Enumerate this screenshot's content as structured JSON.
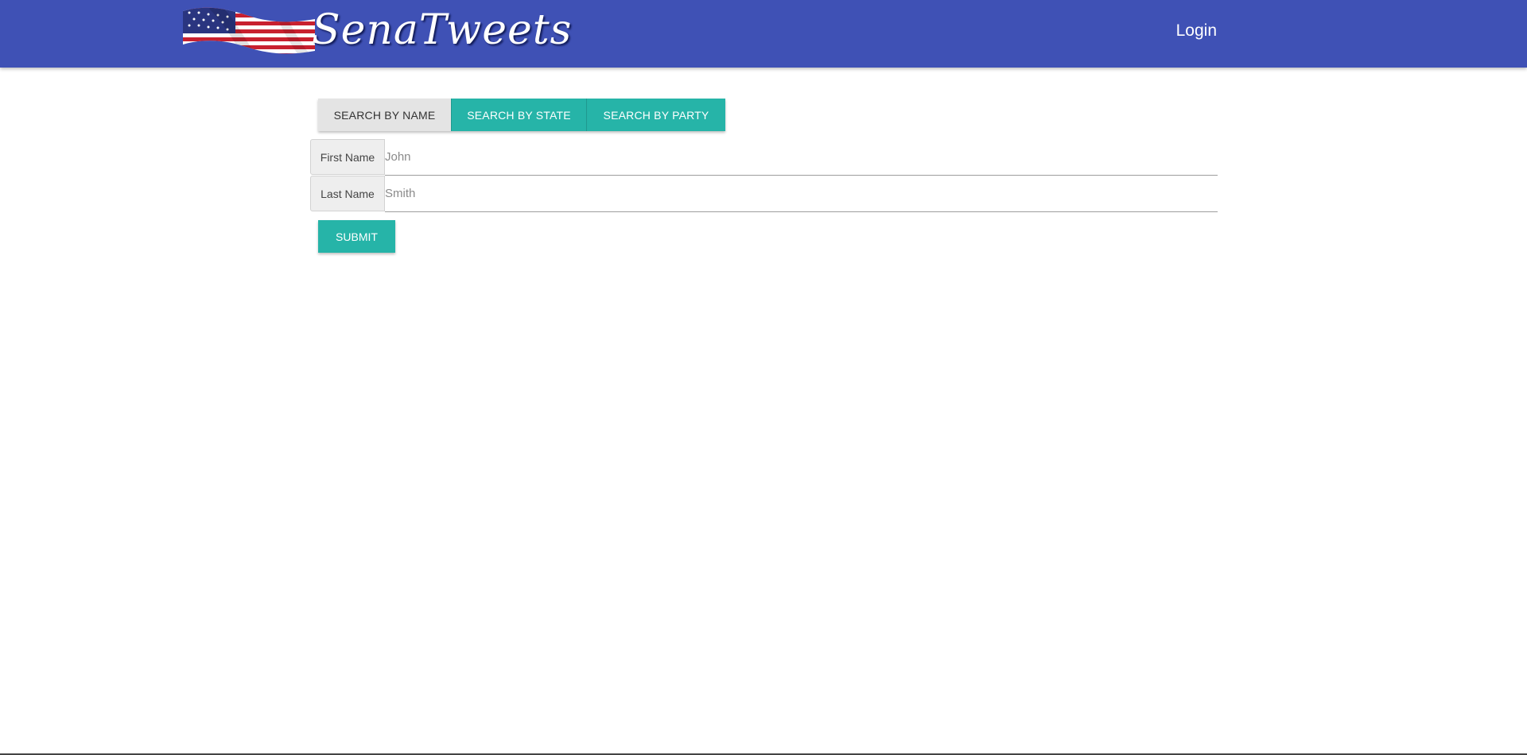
{
  "header": {
    "brand_text": "SenaTweets",
    "login_label": "Login",
    "bg_color": "#3f51b5"
  },
  "search_tabs": [
    {
      "label": "SEARCH BY NAME",
      "active": true
    },
    {
      "label": "SEARCH BY STATE",
      "active": false
    },
    {
      "label": "SEARCH BY PARTY",
      "active": false
    }
  ],
  "form": {
    "first_name": {
      "label": "First Name",
      "placeholder": "John",
      "value": ""
    },
    "last_name": {
      "label": "Last Name",
      "placeholder": "Smith",
      "value": ""
    },
    "submit_label": "SUBMIT"
  },
  "colors": {
    "primary": "#3f51b5",
    "accent": "#26b4a8",
    "tab_active_bg": "#e4e4e4"
  }
}
